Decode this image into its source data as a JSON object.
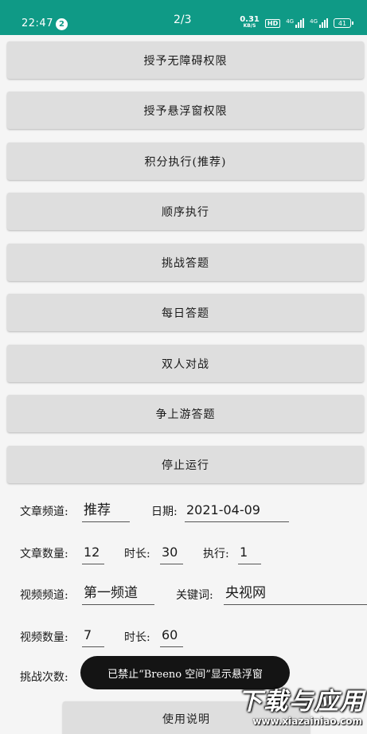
{
  "status_bar": {
    "time": "22:47",
    "notification_count": "2",
    "page_indicator": "2/3",
    "net_speed_value": "0.31",
    "net_speed_unit": "KB/S",
    "hd_label": "HD",
    "sim1_label": "4G",
    "sim2_label": "4G",
    "battery": "41"
  },
  "buttons": [
    {
      "label": "授予无障碍权限"
    },
    {
      "label": "授予悬浮窗权限"
    },
    {
      "label": "积分执行(推荐)"
    },
    {
      "label": "顺序执行"
    },
    {
      "label": "挑战答题"
    },
    {
      "label": "每日答题"
    },
    {
      "label": "双人对战"
    },
    {
      "label": "争上游答题"
    },
    {
      "label": "停止运行"
    }
  ],
  "form": {
    "article_channel_label": "文章频道:",
    "article_channel_value": "推荐",
    "date_label": "日期:",
    "date_value": "2021-04-09",
    "article_count_label": "文章数量:",
    "article_count_value": "12",
    "duration_label": "时长:",
    "duration_value": "30",
    "execute_label": "执行:",
    "execute_value": "1",
    "video_channel_label": "视频频道:",
    "video_channel_value": "第一频道",
    "keyword_label": "关键词:",
    "keyword_value": "央视网",
    "video_count_label": "视频数量:",
    "video_count_value": "7",
    "video_duration_label": "时长:",
    "video_duration_value": "60",
    "challenge_count_label": "挑战次数:"
  },
  "toast": {
    "message": "已禁止“Breeno 空间”显示悬浮窗"
  },
  "help_button": {
    "label": "使用说明"
  },
  "watermark": {
    "main": "下载与应用",
    "sub": "www.xiazainiao.com"
  }
}
